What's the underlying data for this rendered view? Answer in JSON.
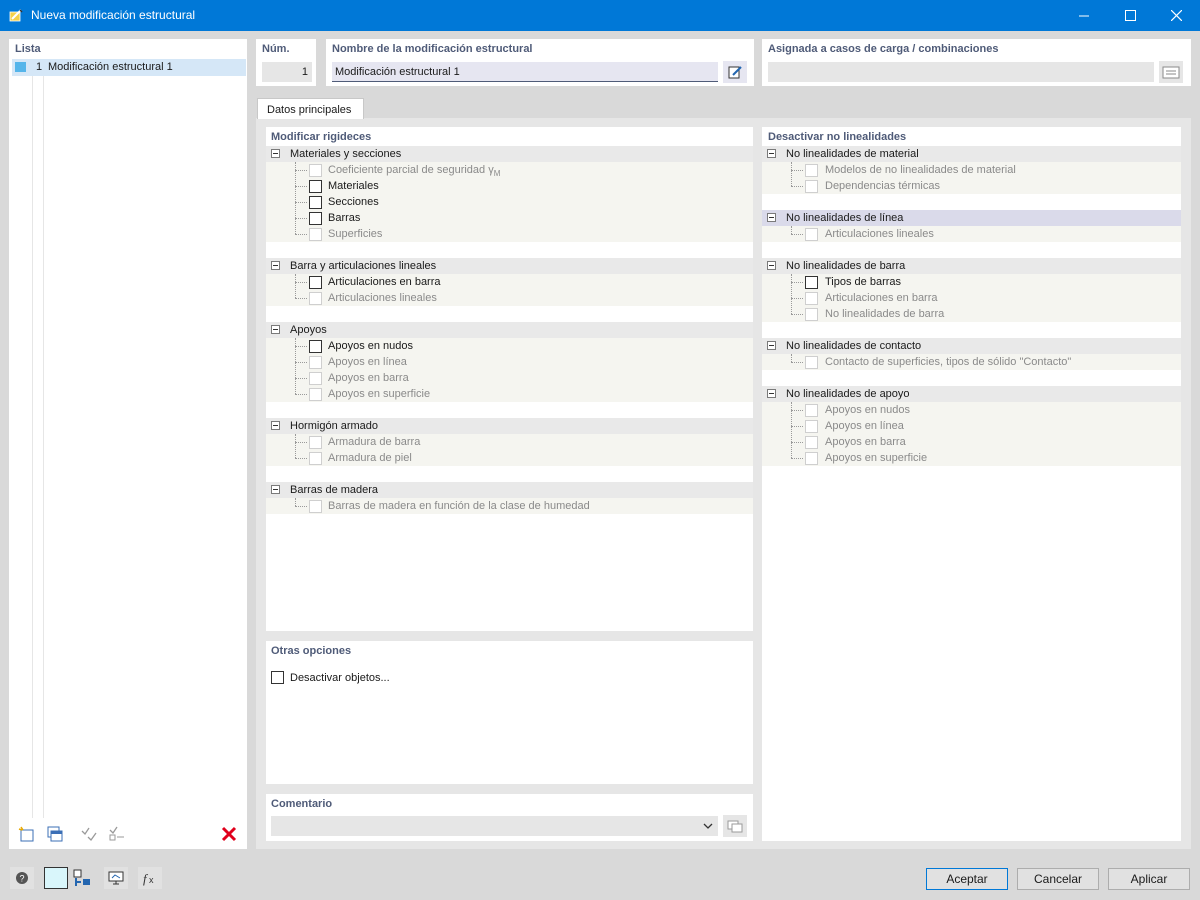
{
  "window": {
    "title": "Nueva modificación estructural"
  },
  "list": {
    "header": "Lista",
    "items": [
      {
        "num": "1",
        "label": "Modificación estructural 1"
      }
    ]
  },
  "num": {
    "header": "Núm.",
    "value": "1"
  },
  "name": {
    "header": "Nombre de la modificación estructural",
    "value": "Modificación estructural 1"
  },
  "assigned": {
    "header": "Asignada a casos de carga / combinaciones",
    "value": ""
  },
  "tabs": [
    {
      "label": "Datos principales"
    }
  ],
  "stiffness": {
    "header": "Modificar rigideces",
    "groups": [
      {
        "label": "Materiales y secciones",
        "items": [
          {
            "label": "Coeficiente parcial de seguridad γ",
            "sub": "M",
            "enabled": false
          },
          {
            "label": "Materiales",
            "enabled": true
          },
          {
            "label": "Secciones",
            "enabled": true
          },
          {
            "label": "Barras",
            "enabled": true
          },
          {
            "label": "Superficies",
            "enabled": false
          }
        ]
      },
      {
        "label": "Barra y articulaciones lineales",
        "items": [
          {
            "label": "Articulaciones en barra",
            "enabled": true
          },
          {
            "label": "Articulaciones lineales",
            "enabled": false
          }
        ]
      },
      {
        "label": "Apoyos",
        "items": [
          {
            "label": "Apoyos en nudos",
            "enabled": true
          },
          {
            "label": "Apoyos en línea",
            "enabled": false
          },
          {
            "label": "Apoyos en barra",
            "enabled": false
          },
          {
            "label": "Apoyos en superficie",
            "enabled": false
          }
        ]
      },
      {
        "label": "Hormigón armado",
        "items": [
          {
            "label": "Armadura de barra",
            "enabled": false
          },
          {
            "label": "Armadura de piel",
            "enabled": false
          }
        ]
      },
      {
        "label": "Barras de madera",
        "items": [
          {
            "label": "Barras de madera en función de la clase de humedad",
            "enabled": false
          }
        ]
      }
    ]
  },
  "nonlin": {
    "header": "Desactivar no linealidades",
    "groups": [
      {
        "label": "No linealidades de material",
        "items": [
          {
            "label": "Modelos de no linealidades de material",
            "enabled": false
          },
          {
            "label": "Dependencias térmicas",
            "enabled": false
          }
        ]
      },
      {
        "label": "No linealidades de línea",
        "selected": true,
        "items": [
          {
            "label": "Articulaciones lineales",
            "enabled": false
          }
        ]
      },
      {
        "label": "No linealidades de barra",
        "items": [
          {
            "label": "Tipos de barras",
            "enabled": true
          },
          {
            "label": "Articulaciones en barra",
            "enabled": false
          },
          {
            "label": "No linealidades de barra",
            "enabled": false
          }
        ]
      },
      {
        "label": "No linealidades de contacto",
        "items": [
          {
            "label": "Contacto de superficies, tipos de sólido \"Contacto\"",
            "enabled": false
          }
        ]
      },
      {
        "label": "No linealidades de apoyo",
        "items": [
          {
            "label": "Apoyos en nudos",
            "enabled": false
          },
          {
            "label": "Apoyos en línea",
            "enabled": false
          },
          {
            "label": "Apoyos en barra",
            "enabled": false
          },
          {
            "label": "Apoyos en superficie",
            "enabled": false
          }
        ]
      }
    ]
  },
  "other": {
    "header": "Otras opciones",
    "deactivate_label": "Desactivar objetos..."
  },
  "comment": {
    "header": "Comentario",
    "value": ""
  },
  "buttons": {
    "accept": "Aceptar",
    "cancel": "Cancelar",
    "apply": "Aplicar"
  },
  "colors": {
    "titlebar": "#0078d7",
    "header_text": "#4f5b78",
    "delete": "#e0001b"
  }
}
